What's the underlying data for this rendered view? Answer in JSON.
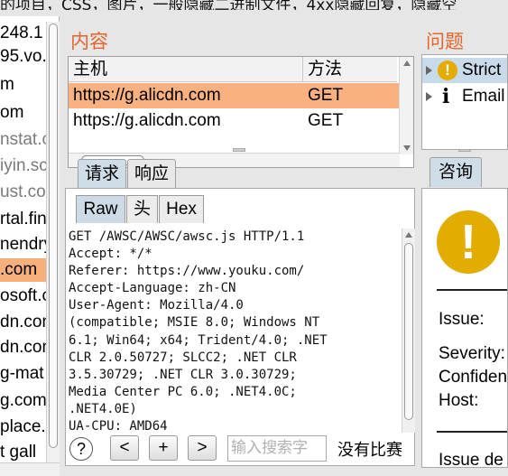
{
  "top_banner": "的项目，CSS，图片，一般隐藏二进制文件，4xx隐藏回复，隐藏空",
  "left_list": {
    "items": [
      {
        "label": "248.1",
        "style": "normal"
      },
      {
        "label": "95.vo.",
        "style": "normal"
      },
      {
        "label": "m",
        "style": "normal"
      },
      {
        "label": "om",
        "style": "normal"
      },
      {
        "label": "nstat.c",
        "style": "gray"
      },
      {
        "label": "iyin.sc",
        "style": "gray"
      },
      {
        "label": "ust.cor",
        "style": "gray"
      },
      {
        "label": "rtal.fin",
        "style": "normal"
      },
      {
        "label": "nendry",
        "style": "normal"
      },
      {
        "label": ".com",
        "style": "selected"
      },
      {
        "label": "osoft.c",
        "style": "normal"
      },
      {
        "label": "dn.com",
        "style": "normal"
      },
      {
        "label": "dn.com",
        "style": "normal"
      },
      {
        "label": "g-mat",
        "style": "normal"
      },
      {
        "label": "g.com",
        "style": "normal"
      },
      {
        "label": "place.v",
        "style": "normal"
      },
      {
        "label": "t gall",
        "style": "normal"
      }
    ]
  },
  "content": {
    "title": "内容",
    "columns": {
      "host": "主机",
      "method": "方法"
    },
    "rows": [
      {
        "host": "https://g.alicdn.com",
        "method": "GET",
        "selected": true
      },
      {
        "host": "https://g.alicdn.com",
        "method": "GET",
        "selected": false
      }
    ]
  },
  "request_tabs": {
    "request": "请求",
    "response": "响应"
  },
  "view_tabs": {
    "raw": "Raw",
    "headers": "头",
    "hex": "Hex"
  },
  "raw_request_lines": [
    "GET /AWSC/AWSC/awsc.js HTTP/1.1",
    "Accept: */*",
    "Referer: https://www.youku.com/",
    "Accept-Language: zh-CN",
    "User-Agent: Mozilla/4.0",
    "(compatible; MSIE 8.0; Windows NT",
    "6.1; Win64; x64; Trident/4.0; .NET",
    "CLR 2.0.50727; SLCC2; .NET CLR",
    "3.5.30729; .NET CLR 3.0.30729;",
    "Media Center PC 6.0; .NET4.0C;",
    ".NET4.0E)",
    "UA-CPU: AMD64"
  ],
  "footer": {
    "help": "?",
    "prev": "<",
    "add": "+",
    "next": ">",
    "search_placeholder": "输入搜索字",
    "match_status": "没有比赛"
  },
  "issues": {
    "title": "问题",
    "items": [
      {
        "label": "Strict",
        "icon": "warning-icon",
        "selected": true
      },
      {
        "label": "Email",
        "icon": "info-icon",
        "selected": false
      }
    ]
  },
  "advisory": {
    "tab": "咨询",
    "issue_label": "Issue:",
    "severity_label": "Severity:",
    "confidence_label": "Confiden",
    "host_label": "Host:",
    "issue_detail_label": "Issue de"
  },
  "colors": {
    "accent_orange": "#e8642a",
    "selection_orange": "#f9b17f",
    "warning_yellow": "#e2ad00",
    "tab_active": "#cfdde8"
  }
}
